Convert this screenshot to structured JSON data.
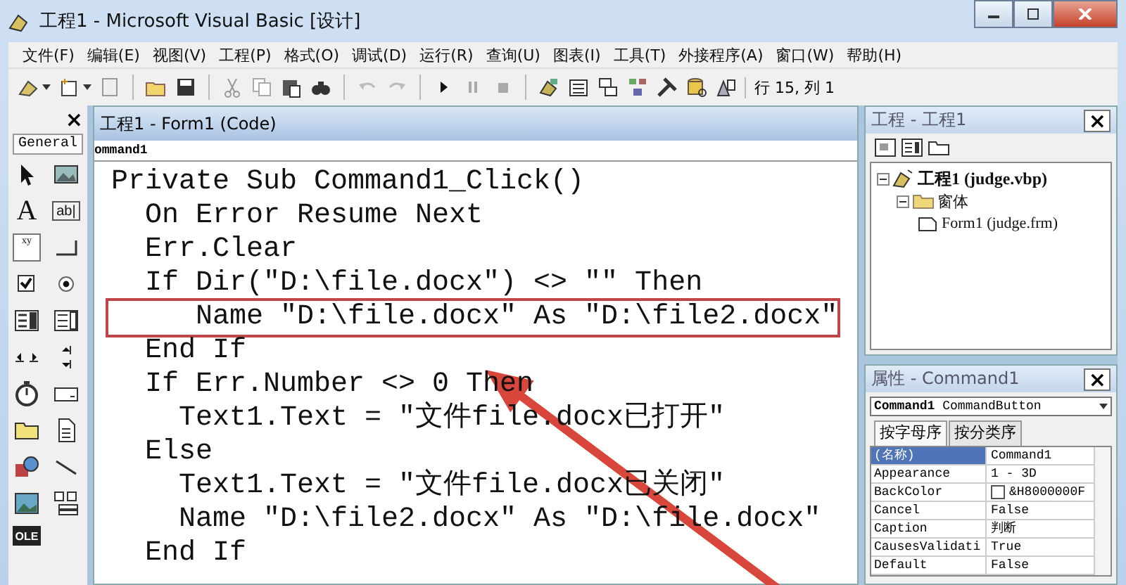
{
  "window": {
    "title": "工程1 - Microsoft Visual Basic [设计]"
  },
  "menu": [
    "文件(F)",
    "编辑(E)",
    "视图(V)",
    "工程(P)",
    "格式(O)",
    "调试(D)",
    "运行(R)",
    "查询(U)",
    "图表(I)",
    "工具(T)",
    "外接程序(A)",
    "窗口(W)",
    "帮助(H)"
  ],
  "toolbar": {
    "position": "行 15, 列 1"
  },
  "toolbox": {
    "close": "×",
    "tab": "General",
    "tools": [
      {
        "kind": "pointer"
      },
      {
        "kind": "picture"
      },
      {
        "kind": "label",
        "glyph": "A"
      },
      {
        "kind": "textbox",
        "glyph": "ab|"
      },
      {
        "kind": "frame",
        "glyph": "xy"
      },
      {
        "kind": "button"
      },
      {
        "kind": "check"
      },
      {
        "kind": "radio"
      },
      {
        "kind": "combo"
      },
      {
        "kind": "list"
      },
      {
        "kind": "hscroll"
      },
      {
        "kind": "vscroll"
      },
      {
        "kind": "timer"
      },
      {
        "kind": "drive"
      },
      {
        "kind": "folder"
      },
      {
        "kind": "file"
      },
      {
        "kind": "shape"
      },
      {
        "kind": "line"
      },
      {
        "kind": "image"
      },
      {
        "kind": "data"
      },
      {
        "kind": "ole",
        "glyph": "OLE"
      }
    ]
  },
  "code_window": {
    "title": "工程1 - Form1 (Code)",
    "object": "ommand1",
    "lines": [
      {
        "text": "Private Sub Command1_Click()",
        "highlighted": false
      },
      {
        "text": "  On Error Resume Next",
        "highlighted": false
      },
      {
        "text": "  Err.Clear",
        "highlighted": false
      },
      {
        "text": "  If Dir(\"D:\\file.docx\") <> \"\" Then",
        "highlighted": false
      },
      {
        "text": "     Name \"D:\\file.docx\" As \"D:\\file2.docx\"",
        "highlighted": true
      },
      {
        "text": "  End If",
        "highlighted": false
      },
      {
        "text": "  If Err.Number <> 0 Then",
        "highlighted": false
      },
      {
        "text": "    Text1.Text = \"文件file.docx已打开\"",
        "highlighted": false
      },
      {
        "text": "  Else",
        "highlighted": false
      },
      {
        "text": "    Text1.Text = \"文件file.docx已关闭\"",
        "highlighted": false
      },
      {
        "text": "    Name \"D:\\file2.docx\" As \"D:\\file.docx\"",
        "highlighted": false
      },
      {
        "text": "  End If",
        "highlighted": false
      }
    ]
  },
  "project": {
    "title": "工程 - 工程1",
    "close": "×",
    "tree": [
      {
        "label": "工程1 (judge.vbp)",
        "kind": "project",
        "expanded": true,
        "children": [
          {
            "label": "窗体",
            "kind": "folder",
            "expanded": true,
            "children": [
              {
                "label": "Form1 (judge.frm)",
                "kind": "form"
              }
            ]
          }
        ]
      }
    ]
  },
  "properties": {
    "title": "属性 - Command1",
    "close": "×",
    "object": "**Command1** CommandButton",
    "tabs": [
      {
        "label": "按字母序",
        "selected": true
      },
      {
        "label": "按分类序",
        "selected": false
      }
    ],
    "rows": [
      {
        "name": "(名称)",
        "value": "Command1",
        "selected": true
      },
      {
        "name": "Appearance",
        "value": "1 - 3D",
        "selected": false
      },
      {
        "name": "BackColor",
        "value": "&H8000000F",
        "selected": false,
        "kind": "color"
      },
      {
        "name": "Cancel",
        "value": "False",
        "selected": false
      },
      {
        "name": "Caption",
        "value": "判断",
        "selected": false
      },
      {
        "name": "CausesValidati",
        "value": "True",
        "selected": false
      },
      {
        "name": "Default",
        "value": "False",
        "selected": false
      }
    ]
  }
}
